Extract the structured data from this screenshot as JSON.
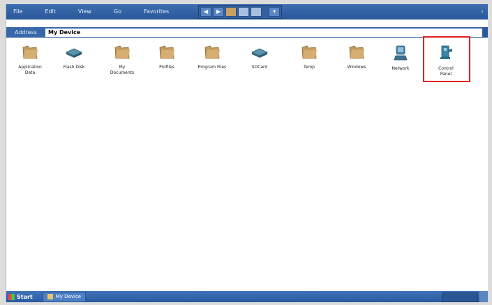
{
  "menu": {
    "items": [
      "File",
      "Edit",
      "View",
      "Go",
      "Favorites"
    ]
  },
  "toolbar": {
    "buttons": [
      "back-icon",
      "forward-icon",
      "folder-up-icon",
      "cut-icon",
      "copy-icon",
      "views-icon"
    ]
  },
  "address": {
    "label": "Address",
    "value": "My Device"
  },
  "icons": [
    {
      "label": "Application\nData",
      "type": "folder"
    },
    {
      "label": "Flash Disk",
      "type": "drive"
    },
    {
      "label": "My\nDocuments",
      "type": "folder"
    },
    {
      "label": "Profiles",
      "type": "folder"
    },
    {
      "label": "Program Files",
      "type": "folder"
    },
    {
      "label": "SDCard",
      "type": "drive"
    },
    {
      "label": "Temp",
      "type": "folder"
    },
    {
      "label": "Windows",
      "type": "folder"
    },
    {
      "label": "Network",
      "type": "network"
    },
    {
      "label": "Control\nPanel",
      "type": "control-panel",
      "highlighted": true
    }
  ],
  "taskbar": {
    "start_label": "Start",
    "window_label": "My Device"
  },
  "colors": {
    "bar_blue": "#2b5a9a",
    "folder": "#c49a5e",
    "drive": "#4a7f9a",
    "highlight": "#e02020"
  }
}
